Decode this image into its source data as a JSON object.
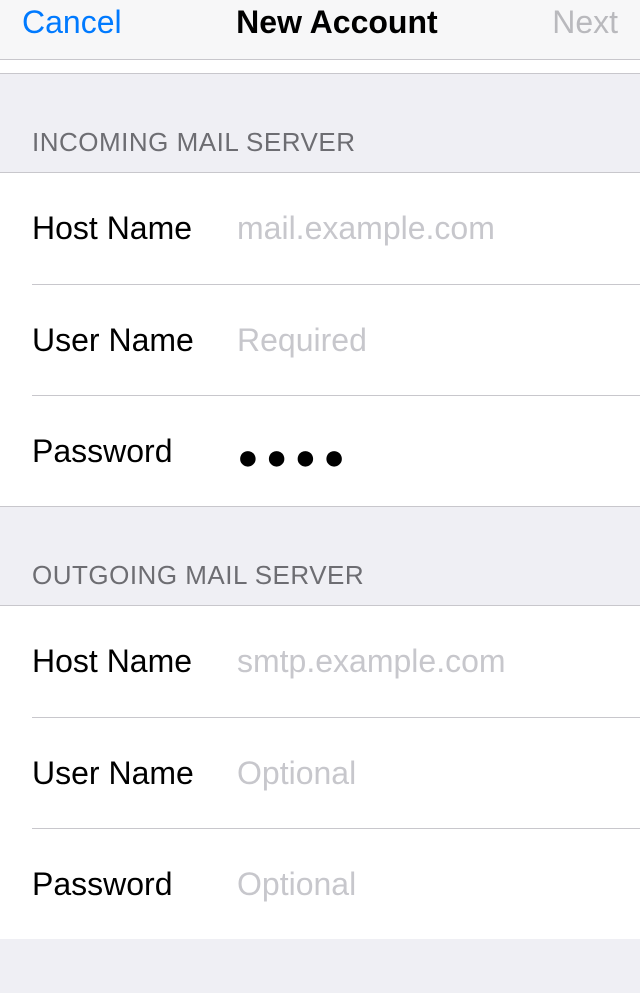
{
  "nav": {
    "cancel": "Cancel",
    "title": "New Account",
    "next": "Next"
  },
  "incoming": {
    "header": "Incoming Mail Server",
    "host_label": "Host Name",
    "host_placeholder": "mail.example.com",
    "host_value": "",
    "user_label": "User Name",
    "user_placeholder": "Required",
    "user_value": "",
    "password_label": "Password",
    "password_display": "●●●●"
  },
  "outgoing": {
    "header": "Outgoing Mail Server",
    "host_label": "Host Name",
    "host_placeholder": "smtp.example.com",
    "host_value": "",
    "user_label": "User Name",
    "user_placeholder": "Optional",
    "user_value": "",
    "password_label": "Password",
    "password_placeholder": "Optional",
    "password_value": ""
  }
}
